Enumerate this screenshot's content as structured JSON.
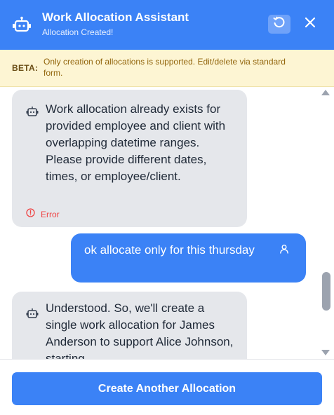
{
  "header": {
    "title": "Work Allocation Assistant",
    "subtitle": "Allocation Created!",
    "bot_icon": "bot-icon",
    "refresh_icon": "refresh-icon",
    "close_icon": "close-icon"
  },
  "banner": {
    "label": "BETA:",
    "text": "Only creation of allocations is supported. Edit/delete via standard form."
  },
  "messages": [
    {
      "role": "assistant",
      "icon": "bot-icon",
      "text": "Work allocation already exists for provided employee and client with overlapping datetime ranges. Please provide different dates, times, or employee/client.",
      "status_icon": "error-icon",
      "status": "Error"
    },
    {
      "role": "user",
      "icon": "user-icon",
      "text": "ok allocate only for this thursday"
    },
    {
      "role": "assistant",
      "icon": "bot-icon",
      "text": "Understood. So, we'll create a single work allocation for James Anderson to support Alice Johnson, starting"
    }
  ],
  "footer": {
    "button_label": "Create Another Allocation"
  },
  "colors": {
    "primary": "#3b82f6",
    "banner_bg": "#fdf5d3",
    "bot_bubble": "#e5e7eb",
    "error": "#ef4444"
  }
}
